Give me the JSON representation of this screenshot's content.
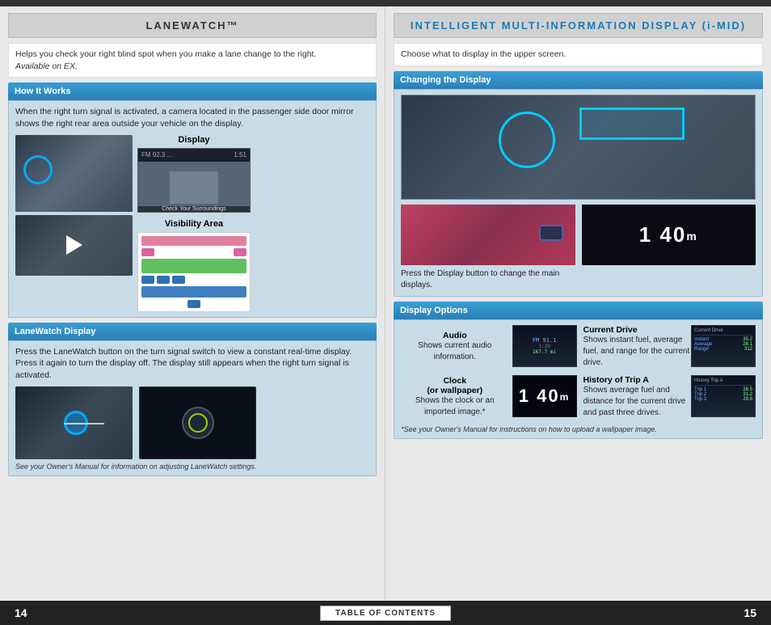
{
  "left_page": {
    "title": "LANEWATCH™",
    "intro": "Helps you check your right blind spot when you make a lane change to the right.",
    "intro_italic": "Available on EX.",
    "how_it_works": {
      "header": "How It Works",
      "description": "When the right turn signal is activated, a camera located in the passenger side door mirror shows the right rear area outside your vehicle on the display.",
      "display_label": "Display",
      "visibility_label": "Visibility Area"
    },
    "lanewatch_display": {
      "header": "LaneWatch Display",
      "description": "Press the LaneWatch button on the turn signal switch to view a constant real-time display. Press it again to turn the display off. The display still appears when the right turn signal is activated.",
      "caption": "See your Owner's Manual for information on adjusting LaneWatch settings."
    }
  },
  "right_page": {
    "title": "INTELLIGENT MULTI-INFORMATION DISPLAY (i-MID)",
    "intro": "Choose what to display in the upper screen.",
    "changing_display": {
      "header": "Changing the Display",
      "button_text": "Press the Display button to change the main displays."
    },
    "display_options": {
      "header": "Display Options",
      "items": [
        {
          "title": "Audio",
          "description": "Shows current audio information."
        },
        {
          "title": "Current Drive",
          "description": "Shows instant fuel, average fuel, and range for the current drive."
        },
        {
          "title": "Clock\n(or wallpaper)",
          "description": "Shows the clock or an imported image.*"
        },
        {
          "title": "History of  Trip A",
          "description": "Shows average fuel and distance for the current drive and past three drives."
        }
      ],
      "footnote": "*See your Owner's Manual for instructions on how to upload a wallpaper image."
    }
  },
  "bottom_bar": {
    "page_left": "14",
    "page_right": "15",
    "toc_label": "TABLE OF CONTENTS"
  },
  "colors": {
    "blue_header": "#2a7fb5",
    "light_blue_bg": "#c8dce8",
    "accent_cyan": "#00aaff"
  }
}
